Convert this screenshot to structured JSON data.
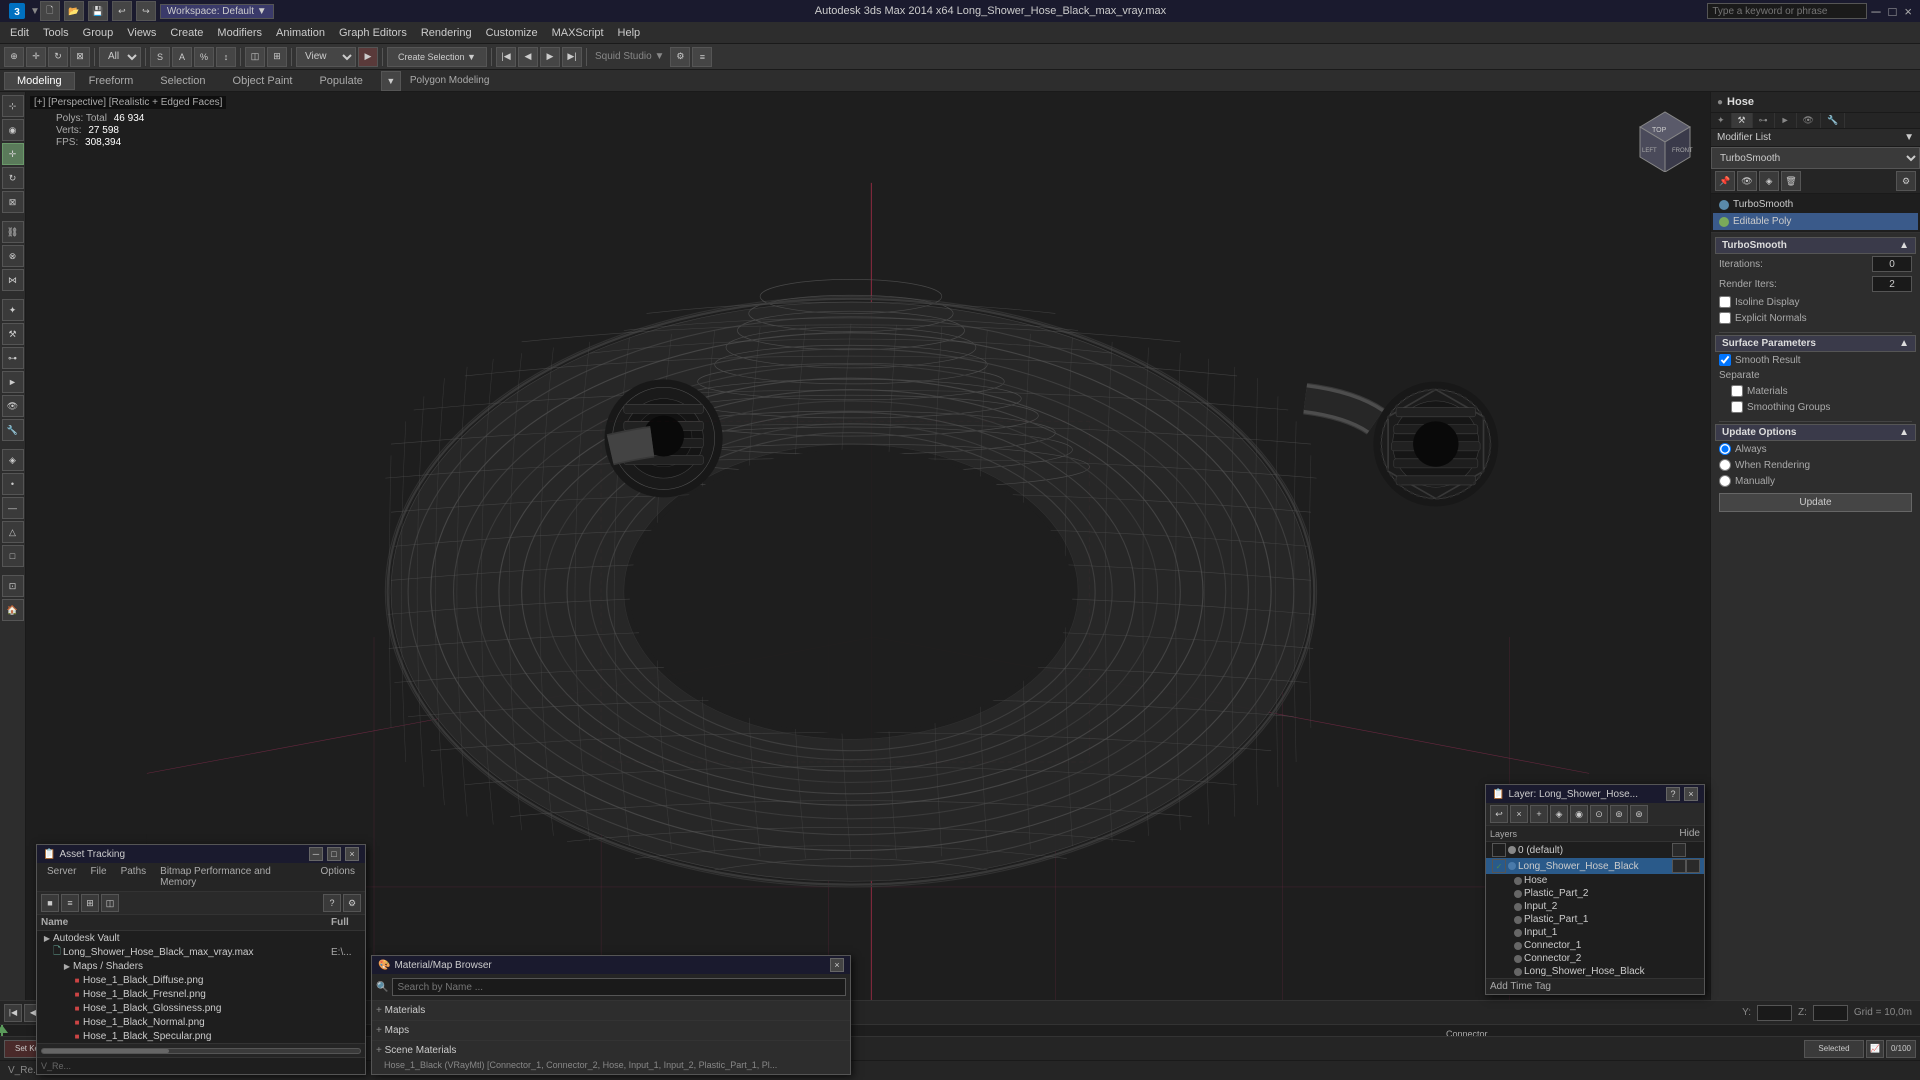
{
  "titlebar": {
    "title": "Autodesk 3ds Max 2014 x64    Long_Shower_Hose_Black_max_vray.max",
    "search_placeholder": "Type a keyword or phrase",
    "logo": "3dsmax-logo",
    "minimize": "─",
    "maximize": "□",
    "close": "×"
  },
  "menubar": {
    "items": [
      "Edit",
      "Tools",
      "Group",
      "Views",
      "Create",
      "Modifiers",
      "Animation",
      "Graph Editors",
      "Rendering",
      "Customize",
      "MAXScript",
      "Help"
    ]
  },
  "modetabs": {
    "tabs": [
      "Modeling",
      "Freeform",
      "Selection",
      "Object Paint",
      "Populate"
    ],
    "active": "Modeling",
    "sublabel": "Polygon Modeling"
  },
  "viewport": {
    "label": "[+] [Perspective] [Realistic + Edged Faces]",
    "polys_label": "Total",
    "polys": "46 934",
    "verts": "27 598",
    "fps_label": "FPS:",
    "fps": "308,394"
  },
  "rightpanel": {
    "title": "Hose",
    "modifier_list_label": "Modifier List",
    "modifiers": [
      {
        "name": "TurboSmooth",
        "color": "#5a8aaa",
        "selected": false
      },
      {
        "name": "Editable Poly",
        "color": "#7aaa5a",
        "selected": true
      }
    ],
    "sections": {
      "main": {
        "title": "TurboSmooth",
        "iterations_label": "Iterations:",
        "iterations_value": "0",
        "render_iters_label": "Render Iters:",
        "render_iters_value": "2",
        "isoline_display": "Isoline Display",
        "explicit_normals": "Explicit Normals"
      },
      "surface": {
        "title": "Surface Parameters",
        "smooth_result": "Smooth Result",
        "separate": "Separate",
        "materials": "Materials",
        "smoothing_groups": "Smoothing Groups"
      },
      "update": {
        "title": "Update Options",
        "always": "Always",
        "when_rendering": "When Rendering",
        "manually": "Manually",
        "update_btn": "Update"
      }
    }
  },
  "asset_tracking": {
    "title": "Asset Tracking",
    "menu": [
      "Server",
      "File",
      "Paths",
      "Bitmap Performance and Memory",
      "Options"
    ],
    "cols": {
      "name": "Name",
      "full": "Full"
    },
    "tree": [
      {
        "indent": 0,
        "icon": "folder",
        "name": "Autodesk Vault",
        "value": ""
      },
      {
        "indent": 1,
        "icon": "file",
        "name": "Long_Shower_Hose_Black_max_vray.max",
        "value": "E:\\..."
      },
      {
        "indent": 2,
        "icon": "folder",
        "name": "Maps / Shaders",
        "value": ""
      },
      {
        "indent": 3,
        "icon": "image",
        "name": "Hose_1_Black_Diffuse.png",
        "value": ""
      },
      {
        "indent": 3,
        "icon": "image",
        "name": "Hose_1_Black_Fresnel.png",
        "value": ""
      },
      {
        "indent": 3,
        "icon": "image",
        "name": "Hose_1_Black_Glossiness.png",
        "value": ""
      },
      {
        "indent": 3,
        "icon": "image",
        "name": "Hose_1_Black_Normal.png",
        "value": ""
      },
      {
        "indent": 3,
        "icon": "image",
        "name": "Hose_1_Black_Specular.png",
        "value": ""
      }
    ]
  },
  "material_browser": {
    "title": "Material/Map Browser",
    "search_placeholder": "Search by Name ...",
    "sections": [
      {
        "label": "Materials"
      },
      {
        "label": "Maps"
      },
      {
        "label": "Scene Materials"
      }
    ],
    "scene_content": "Hose_1_Black (VRayMtl) [Connector_1, Connector_2, Hose, Input_1, Input_2, Plastic_Part_1, Pl..."
  },
  "layers": {
    "title": "Layer: Long_Shower_Hose...",
    "cols": {
      "layers": "Layers",
      "hide": "Hide"
    },
    "items": [
      {
        "indent": 0,
        "name": "0 (default)",
        "checked": false,
        "selected": false
      },
      {
        "indent": 1,
        "name": "Long_Shower_Hose_Black",
        "checked": true,
        "selected": true,
        "children": [
          {
            "name": "Hose"
          },
          {
            "name": "Plastic_Part_2"
          },
          {
            "name": "Input_2"
          },
          {
            "name": "Plastic_Part_1"
          },
          {
            "name": "Input_1"
          },
          {
            "name": "Connector_1"
          },
          {
            "name": "Connector_2"
          },
          {
            "name": "Long_Shower_Hose_Black"
          }
        ]
      }
    ],
    "add_time_tag": "Add Time Tag"
  },
  "timeline": {
    "frame_start": "0",
    "frame_end": "100",
    "current_frame": "0",
    "grid_label": "Grid = 10,0m",
    "y_label": "Y:",
    "z_label": "Z:",
    "connector_label": "Connector"
  },
  "statusbar": {
    "text": "V_Re..."
  }
}
